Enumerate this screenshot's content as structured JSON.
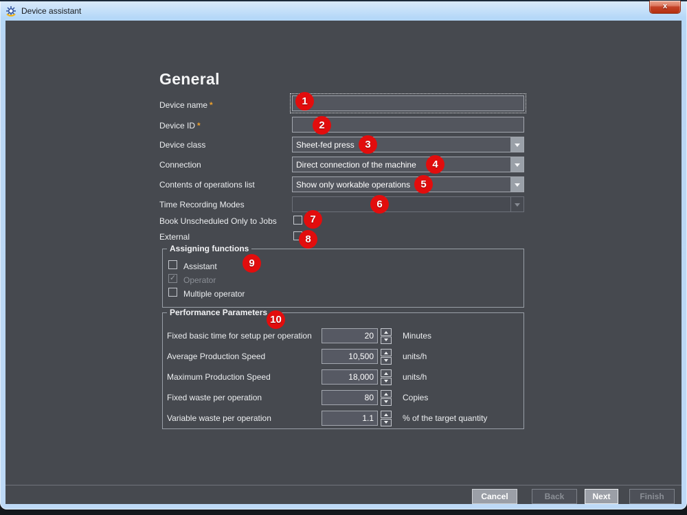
{
  "window": {
    "title": "Device assistant",
    "close_glyph": "x"
  },
  "page": {
    "heading": "General"
  },
  "glyphs": {
    "check": "✓"
  },
  "colors": {
    "content_bg": "#46494f",
    "input_bg": "#53565e",
    "border": "#a4a8b0",
    "titlebar_blue": "#b5d8f8",
    "badge_red": "#e20d0d",
    "required_orange": "#eda12d",
    "close_red": "#b5310f"
  },
  "form": {
    "device_name": {
      "label": "Device name",
      "required_marker": "*",
      "value": ""
    },
    "device_id": {
      "label": "Device ID",
      "required_marker": "*",
      "value": ""
    },
    "device_class": {
      "label": "Device class",
      "value": "Sheet-fed press"
    },
    "connection": {
      "label": "Connection",
      "value": "Direct connection of the machine"
    },
    "operations_list": {
      "label": "Contents of operations list",
      "value": "Show only workable operations"
    },
    "time_recording": {
      "label": "Time Recording Modes",
      "value": ""
    },
    "book_unscheduled": {
      "label": "Book Unscheduled Only to Jobs"
    },
    "external": {
      "label": "External"
    }
  },
  "assigning_functions": {
    "title": "Assigning functions",
    "items": [
      {
        "label": "Assistant"
      },
      {
        "label": "Operator"
      },
      {
        "label": "Multiple operator"
      }
    ]
  },
  "performance_parameters": {
    "title": "Performance Parameters",
    "rows": [
      {
        "label": "Fixed basic time for setup per operation",
        "value": "20",
        "unit": "Minutes"
      },
      {
        "label": "Average Production Speed",
        "value": "10,500",
        "unit": "units/h"
      },
      {
        "label": "Maximum Production Speed",
        "value": "18,000",
        "unit": "units/h"
      },
      {
        "label": "Fixed waste per operation",
        "value": "80",
        "unit": "Copies"
      },
      {
        "label": "Variable waste per operation",
        "value": "1.1",
        "unit": "% of the target quantity"
      }
    ]
  },
  "footer": {
    "cancel": "Cancel",
    "back": "Back",
    "next": "Next",
    "finish": "Finish"
  },
  "annotations": [
    "1",
    "2",
    "3",
    "4",
    "5",
    "6",
    "7",
    "8",
    "9",
    "10"
  ]
}
